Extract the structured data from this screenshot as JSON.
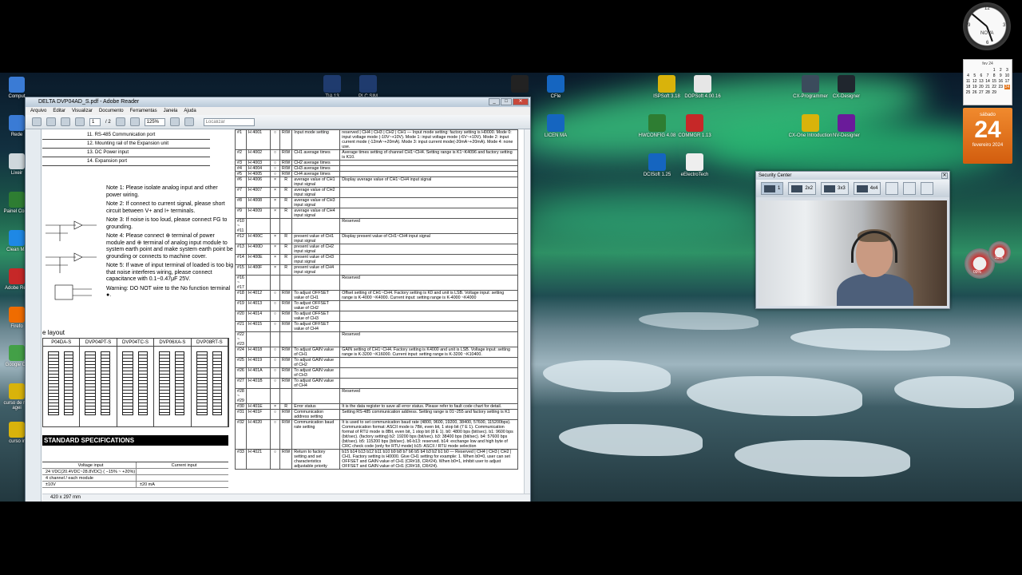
{
  "desktop": {
    "top_icons": [
      {
        "label": "TIA\n13",
        "color": "#1f3b6e"
      },
      {
        "label": "PLC\nSIM",
        "color": "#1f3b6e"
      },
      {
        "label": "",
        "color": "#222222"
      },
      {
        "label": "CFle",
        "color": "#1565c0"
      },
      {
        "label": "ISPSoft 3.18",
        "color": "#d9b30b"
      },
      {
        "label": "DOPSoft 4.00.16",
        "color": "#e6e6e6"
      },
      {
        "label": "CX-Programmer",
        "color": "#3b4b5c"
      },
      {
        "label": "CX-Designer",
        "color": "#20262e"
      }
    ],
    "mid_icons": [
      {
        "label": "LICEN\nMA",
        "color": "#1565c0"
      },
      {
        "label": "HWCONFIG 4.08",
        "color": "#2e7d32"
      },
      {
        "label": "COMMGR 1.13",
        "color": "#c62828"
      },
      {
        "label": "CX-One Introduction",
        "color": "#d9b30b"
      },
      {
        "label": "NV-Designer",
        "color": "#6a1b9a"
      }
    ],
    "low_icons": [
      {
        "label": "DCISoft 1.25",
        "color": "#1565c0"
      },
      {
        "label": "eElectroTech",
        "color": "#eeeeee"
      }
    ],
    "left_icons": [
      {
        "label": "Comput",
        "color": "#3a7bd5"
      },
      {
        "label": "Rede",
        "color": "#3a7bd5"
      },
      {
        "label": "Lixeir",
        "color": "#cfd8dc"
      },
      {
        "label": "Painel Contr",
        "color": "#2e7d32"
      },
      {
        "label": "Clean Ma",
        "color": "#1e88e5"
      },
      {
        "label": "Adobe Rea",
        "color": "#c62828"
      },
      {
        "label": "Firefo",
        "color": "#ef6c00"
      },
      {
        "label": "Google Ch",
        "color": "#43a047"
      },
      {
        "label": "curso de ma agei",
        "color": "#d9b30b"
      },
      {
        "label": "curso ir",
        "color": "#d9b30b"
      }
    ]
  },
  "reader": {
    "title": "DELTA DVP04AD_S.pdf - Adobe Reader",
    "menu": [
      "Arquivo",
      "Editar",
      "Visualizar",
      "Documento",
      "Ferramentas",
      "Janela",
      "Ajuda"
    ],
    "page_current": "1",
    "page_total": "/ 2",
    "zoom": "125%",
    "search_placeholder": "Localizar",
    "status": "420 x 297 mm",
    "left_table": [
      "11. RS-485 Communication port",
      "12. Mounting rail of the Expansion unit",
      "13. DC Power input",
      "14. Expansion port"
    ],
    "notes": [
      "Note 1: Please isolate analog input and other power wiring.",
      "Note 2: If connect to current signal, please short circuit between V+ and I+ terminals.",
      "Note 3: If noise is too loud, please connect FG to grounding.",
      "Note 4: Please connect ⊕ terminal of power module and ⊕ terminal of analog input module to system earth point and make system earth point be grounding or connects to machine cover.",
      "Note 5: If wave of input terminal of loaded is too big that noise interferes wiring, please connect capacitance with 0.1~0.47μF 25V.",
      "Warning: DO NOT wire to the No function terminal ●."
    ],
    "layout_label": "e layout",
    "modules": [
      "P04DA-S",
      "DVP04PT-S",
      "DVP04TC-S",
      "DVP06XA-S",
      "DVP08RT-S"
    ],
    "specs_title": "STANDARD SPECIFICATIONS",
    "specs_header": [
      "Voltage input",
      "Current input"
    ],
    "specs_rows": [
      [
        "24 VDC(20.4VDC~28.8VDC) ( −15% ~ +20%)",
        ""
      ],
      [
        "4 channel / each module",
        ""
      ],
      [
        "±10V",
        "±20 mA"
      ]
    ],
    "cr_rows": [
      {
        "no": "#1",
        "addr": "H 4001",
        "l": "○",
        "rw": "R/W",
        "name": "Input mode setting",
        "desc": "reserved | CH4 | CH3 | CH2 | CH1 — Input mode setting: factory setting is H0000. Mode 0: input voltage mode (-10V~+10V). Mode 1: input voltage mode (-6V~+10V). Mode 2: input current mode (-12mA~+20mA). Mode 3: input current mode(-20mA~+20mA). Mode 4: none use."
      },
      {
        "no": "#2",
        "addr": "H 4002",
        "l": "○",
        "rw": "R/W",
        "name": "CH1 average times",
        "desc": "Average times setting of channel CH1~CH4. Setting range is K1~K4096 and factory setting is K10."
      },
      {
        "no": "#3",
        "addr": "H 4003",
        "l": "○",
        "rw": "R/W",
        "name": "CH2 average times",
        "desc": ""
      },
      {
        "no": "#4",
        "addr": "H 4004",
        "l": "○",
        "rw": "R/W",
        "name": "CH3 average times",
        "desc": ""
      },
      {
        "no": "#5",
        "addr": "H 4005",
        "l": "○",
        "rw": "R/W",
        "name": "CH4 average times",
        "desc": ""
      },
      {
        "no": "#6",
        "addr": "H 4006",
        "l": "×",
        "rw": "R",
        "name": "average value of CH1 input signal",
        "desc": "Display average value of CH1~CH4 input signal"
      },
      {
        "no": "#7",
        "addr": "H 4007",
        "l": "×",
        "rw": "R",
        "name": "average value of CH2 input signal",
        "desc": ""
      },
      {
        "no": "#8",
        "addr": "H 4008",
        "l": "×",
        "rw": "R",
        "name": "average value of CH3 input signal",
        "desc": ""
      },
      {
        "no": "#9",
        "addr": "H 4009",
        "l": "×",
        "rw": "R",
        "name": "average value of CH4 input signal",
        "desc": ""
      },
      {
        "no": "#10 ~ #11",
        "addr": "",
        "l": "",
        "rw": "",
        "name": "",
        "desc": "Reserved"
      },
      {
        "no": "#12",
        "addr": "H 400C",
        "l": "×",
        "rw": "R",
        "name": "present value of CH1 input signal",
        "desc": "Display present value of CH1~CH4 input signal"
      },
      {
        "no": "#13",
        "addr": "H 400D",
        "l": "×",
        "rw": "R",
        "name": "present value of CH2 input signal",
        "desc": ""
      },
      {
        "no": "#14",
        "addr": "H 400E",
        "l": "×",
        "rw": "R",
        "name": "present value of CH3 input signal",
        "desc": ""
      },
      {
        "no": "#15",
        "addr": "H 400F",
        "l": "×",
        "rw": "R",
        "name": "present value of CH4 input signal",
        "desc": ""
      },
      {
        "no": "#16 ~ #17",
        "addr": "",
        "l": "",
        "rw": "",
        "name": "",
        "desc": "Reserved"
      },
      {
        "no": "#18",
        "addr": "H 4012",
        "l": "○",
        "rw": "R/W",
        "name": "To adjust OFFSET value of CH1",
        "desc": "Offset setting of CH1~CH4. Factory setting is K0 and unit is LSB. Voltage input: setting range is K-4000 ~K4000. Current input: setting range is K-4000 ~K4000"
      },
      {
        "no": "#19",
        "addr": "H 4013",
        "l": "○",
        "rw": "R/W",
        "name": "To adjust OFFSET value of CH2",
        "desc": ""
      },
      {
        "no": "#20",
        "addr": "H 4014",
        "l": "○",
        "rw": "R/W",
        "name": "To adjust OFFSET value of CH3",
        "desc": ""
      },
      {
        "no": "#21",
        "addr": "H 4015",
        "l": "○",
        "rw": "R/W",
        "name": "To adjust OFFSET value of CH4",
        "desc": ""
      },
      {
        "no": "#22 ~ #23",
        "addr": "",
        "l": "",
        "rw": "",
        "name": "",
        "desc": "Reserved"
      },
      {
        "no": "#24",
        "addr": "H 4018",
        "l": "○",
        "rw": "R/W",
        "name": "To adjust GAIN value of CH1",
        "desc": "GAIN setting of CH1~CH4. Factory setting is K4000 and unit is LSB. Voltage input: setting range is K-3200 ~K16000. Current input: setting range is K-3200 ~K10400."
      },
      {
        "no": "#25",
        "addr": "H 4019",
        "l": "○",
        "rw": "R/W",
        "name": "To adjust GAIN value of CH2",
        "desc": ""
      },
      {
        "no": "#26",
        "addr": "H 401A",
        "l": "○",
        "rw": "R/W",
        "name": "To adjust GAIN value of CH3",
        "desc": ""
      },
      {
        "no": "#27",
        "addr": "H 401B",
        "l": "○",
        "rw": "R/W",
        "name": "To adjust GAIN value of CH4",
        "desc": ""
      },
      {
        "no": "#28 ~ #29",
        "addr": "",
        "l": "",
        "rw": "",
        "name": "",
        "desc": "Reserved"
      },
      {
        "no": "#30",
        "addr": "H 401E",
        "l": "×",
        "rw": "R",
        "name": "Error status",
        "desc": "It is the data register to save all error status. Please refer to fault code chart for detail."
      },
      {
        "no": "#31",
        "addr": "H 401F",
        "l": "○",
        "rw": "R/W",
        "name": "Communication address setting",
        "desc": "Setting RS-485 communication address. Setting range is 01~255 and factory setting is K1"
      },
      {
        "no": "#32",
        "addr": "H 4020",
        "l": "○",
        "rw": "R/W",
        "name": "Communication baud rate setting",
        "desc": "It is used to set communication baud rate (4800, 9600, 19200, 38400, 57600, 115200bps). Communication format: ASCII mode is 7Bit, even bit, 1 stop bit (7 E 1). Communication format of RTU mode is 8Bit, even bit, 1 stop bit (8 E 1). b0: 4800 bps (bit/sec). b1: 9600 bps (bit/sec). (factory setting) b2: 19200 bps (bit/sec). b3: 38400 bps (bit/sec). b4: 57600 bps (bit/sec). b5: 115200 bps (bit/sec). b6-b13: reserved. b14: exchange low and high byte of CRC check code (only for RTU mode) b15: ASCII / RTU mode selection"
      },
      {
        "no": "#33",
        "addr": "H 4021",
        "l": "○",
        "rw": "R/W",
        "name": "Return to factory setting and set characteristics adjustable priority",
        "desc": "b15 b14 b13 b12 b11 b10 b9 b8 b7 b6 b5 b4 b3 b2 b1 b0 — Reserved | CH4 | CH3 | CH2 | CH1. Factory setting is H0000. Give CH1 setting for example: 1. When b0=0, user can set OFFSET and GAIN value of CH1 (CR#18, CR#24). When b0=1, inhibit user to adjust OFFSET and GAIN value of CH1 (CR#18, CR#24)."
      }
    ]
  },
  "security_center": {
    "title": "Security Center",
    "buttons": [
      "1",
      "2x2",
      "3x3",
      "4x4"
    ]
  },
  "clock": {
    "brand": "NOVA"
  },
  "calendar": {
    "month_header": "fev 24",
    "weekday": "sábado",
    "day": "24",
    "month": "fevereiro 2024",
    "days": [
      "",
      "",
      "",
      "",
      "1",
      "2",
      "3",
      "4",
      "5",
      "6",
      "7",
      "8",
      "9",
      "10",
      "11",
      "12",
      "13",
      "14",
      "15",
      "16",
      "17",
      "18",
      "19",
      "20",
      "21",
      "22",
      "23",
      "24",
      "25",
      "26",
      "27",
      "28",
      "29"
    ]
  },
  "gauges": [
    {
      "label": "09%"
    },
    {
      "label": "35%"
    }
  ]
}
